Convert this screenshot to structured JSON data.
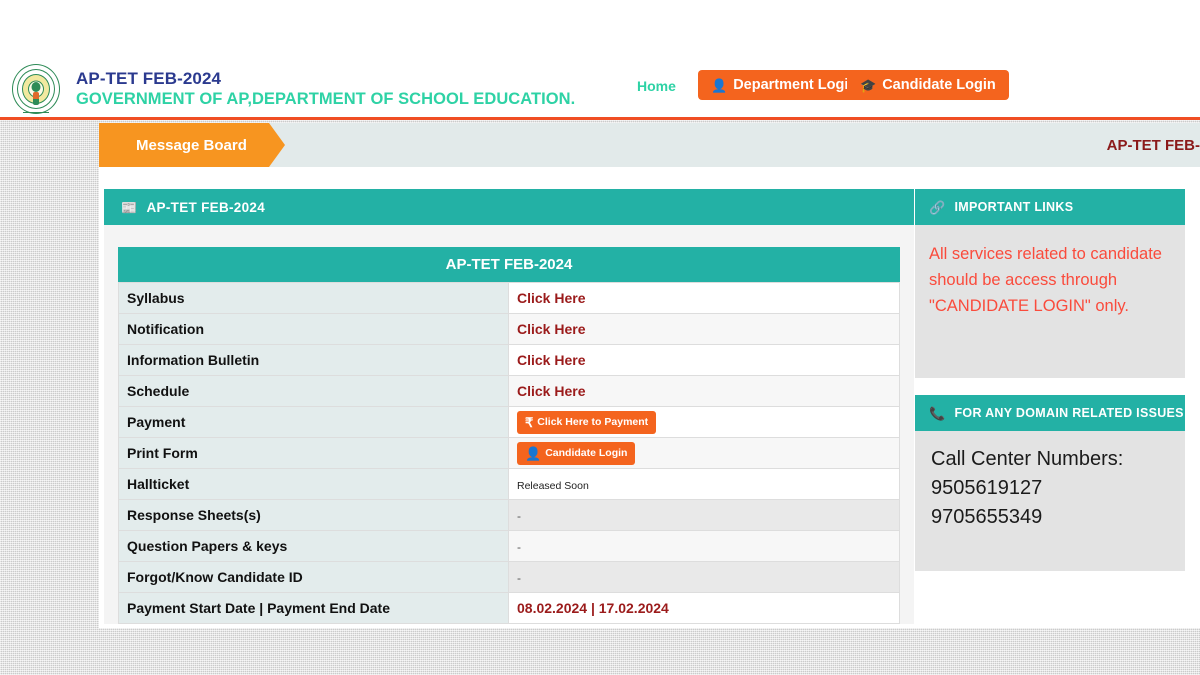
{
  "header": {
    "logo_icon": "ap-state-emblem",
    "title_line1": "AP-TET FEB-2024",
    "title_line2": "GOVERNMENT OF AP,DEPARTMENT OF SCHOOL EDUCATION.",
    "nav_home": "Home",
    "department_login": "Department Login",
    "department_login_icon": "user-icon",
    "candidate_login": "Candidate Login",
    "candidate_login_icon": "graduation-cap-icon"
  },
  "message_board": {
    "tab_label": "Message Board",
    "marquee_text": "AP-TET FEB-"
  },
  "left_panel": {
    "panel_title": "AP-TET FEB-2024",
    "panel_icon": "newspaper-icon",
    "table": {
      "caption": "AP-TET FEB-2024",
      "rows": [
        {
          "label": "Syllabus",
          "value": "Click Here",
          "kind": "link"
        },
        {
          "label": "Notification",
          "value": "Click Here",
          "kind": "link"
        },
        {
          "label": "Information Bulletin",
          "value": "Click Here",
          "kind": "link"
        },
        {
          "label": "Schedule",
          "value": "Click Here",
          "kind": "link"
        },
        {
          "label": "Payment",
          "value": "Click Here to Payment",
          "kind": "button",
          "icon": "rupee-icon"
        },
        {
          "label": "Print Form",
          "value": "Candidate Login",
          "kind": "button",
          "icon": "user-icon"
        },
        {
          "label": "Hallticket",
          "value": "Released Soon",
          "kind": "note"
        },
        {
          "label": "Response Sheets(s)",
          "value": "-",
          "kind": "dash"
        },
        {
          "label": "Question Papers & keys",
          "value": "-",
          "kind": "dash"
        },
        {
          "label": "Forgot/Know Candidate ID",
          "value": "-",
          "kind": "dash"
        },
        {
          "label": "Payment Start Date | Payment End Date",
          "value": "08.02.2024 | 17.02.2024",
          "kind": "date"
        }
      ]
    }
  },
  "right_panel": {
    "important_links": {
      "title": "IMPORTANT LINKS",
      "icon": "link-chain-icon",
      "notice": "All services related to candidate should be access through \"CANDIDATE LOGIN\" only."
    },
    "domain_issues": {
      "title": "FOR ANY DOMAIN RELATED ISSUES",
      "icon": "phone-square-icon",
      "call_center_label": "Call Center Numbers:",
      "number_1": "9505619127",
      "number_2": "9705655349"
    }
  },
  "colors": {
    "orange": "#f4641e",
    "tab_orange": "#f79520",
    "teal": "#23b1a5",
    "brand_green": "#2ed2a5",
    "brand_blue": "#2b3a8f",
    "link_red": "#9b1b1b",
    "notice_red": "#fa4b3c"
  }
}
